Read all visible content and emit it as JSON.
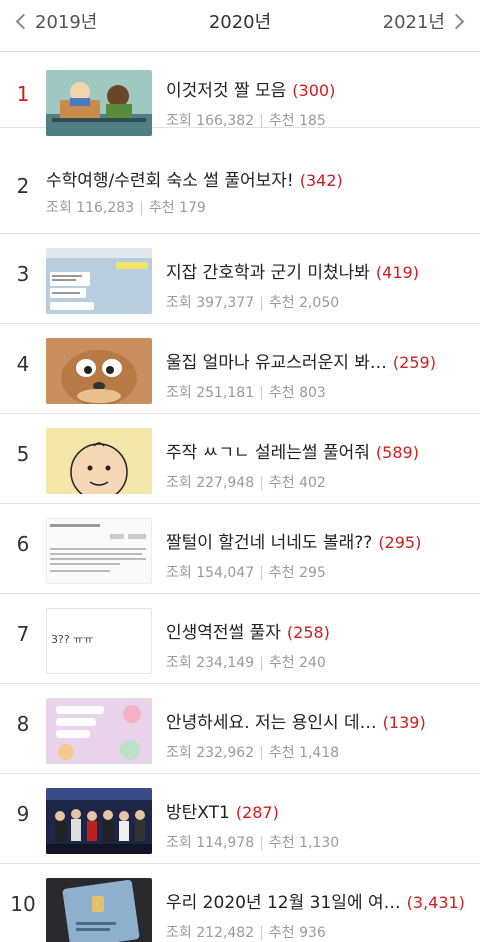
{
  "year_nav": {
    "prev": "2019년",
    "current": "2020년",
    "next": "2021년"
  },
  "labels": {
    "views": "조회",
    "recommend": "추천"
  },
  "posts": [
    {
      "rank": "1",
      "title": "이것저것 짤 모음",
      "comments": "(300)",
      "views": "166,382",
      "recommend": "185",
      "thumb": "cartoon-boys-image"
    },
    {
      "rank": "2",
      "title": "수학여행/수련회 숙소 썰 풀어보자!",
      "comments": "(342)",
      "views": "116,283",
      "recommend": "179",
      "thumb": ""
    },
    {
      "rank": "3",
      "title": "지잡 간호학과 군기 미쳤나봐",
      "comments": "(419)",
      "views": "397,377",
      "recommend": "2,050",
      "thumb": "chat-screenshot-image"
    },
    {
      "rank": "4",
      "title": "울집 얼마나 유교스러운지 봐…",
      "comments": "(259)",
      "views": "251,181",
      "recommend": "803",
      "thumb": "cartoon-mouse-image"
    },
    {
      "rank": "5",
      "title": "주작 ㅆㄱㄴ 설레는썰 풀어줘",
      "comments": "(589)",
      "views": "227,948",
      "recommend": "402",
      "thumb": "cartoon-face-image"
    },
    {
      "rank": "6",
      "title": "짤털이 할건네 너네도 볼래??",
      "comments": "(295)",
      "views": "154,047",
      "recommend": "295",
      "thumb": "text-post-screenshot-image"
    },
    {
      "rank": "7",
      "title": "인생역전썰 풀자",
      "comments": "(258)",
      "views": "234,149",
      "recommend": "240",
      "thumb": "text-snippet-image",
      "thumb_text": "3?? ㅠㅠ"
    },
    {
      "rank": "8",
      "title": "안녕하세요. 저는 용인시 데…",
      "comments": "(139)",
      "views": "232,962",
      "recommend": "1,418",
      "thumb": "pink-chat-image"
    },
    {
      "rank": "9",
      "title": "방탄XT1",
      "comments": "(287)",
      "views": "114,978",
      "recommend": "1,130",
      "thumb": "group-photo-image"
    },
    {
      "rank": "10",
      "title": "우리 2020년 12월 31일에 여…",
      "comments": "(3,431)",
      "views": "212,482",
      "recommend": "936",
      "thumb": "card-photo-image"
    }
  ]
}
